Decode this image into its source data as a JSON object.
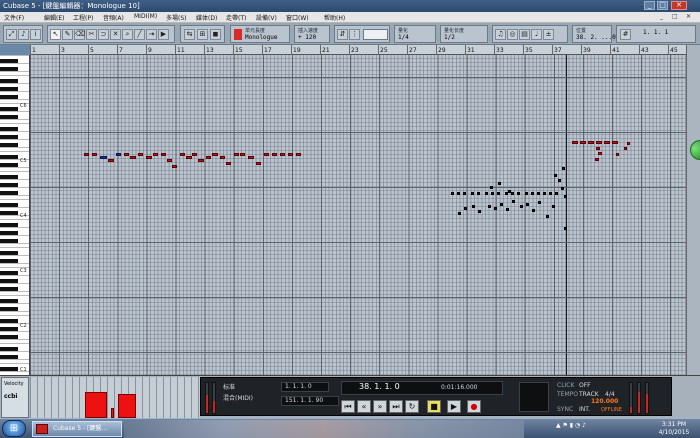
{
  "window": {
    "title": "Cubase 5 - [鍵盤編輯器：Monologue 10]",
    "buttons": [
      "_",
      "□",
      "✕"
    ]
  },
  "menubar": {
    "items": [
      "文件(F)",
      "編輯(E)",
      "工程(P)",
      "音頻(A)",
      "MIDI(M)",
      "多場(S)",
      "媒体(D)",
      "走帶(T)",
      "設備(V)",
      "窗口(W)",
      "帮助(H)"
    ],
    "system_buttons": [
      "_",
      "□",
      "✕"
    ]
  },
  "toolbar": {
    "insert_label": "单元長度",
    "insert_value": "Monologue",
    "quant_label": "插入速度",
    "quant_value": "+ 120",
    "snap_label": "量化",
    "snap_value": "1/4",
    "length_label": "量化长度",
    "length_value": "1/2",
    "pos_label": "位置",
    "pos_value": "38. 2. ...0",
    "end_value": "1. 1. 1",
    "tools": [
      "select",
      "pencil",
      "eraser",
      "scissors",
      "glue",
      "mute",
      "zoom",
      "line",
      "trim",
      "play"
    ]
  },
  "ruler": {
    "marks": [
      "1",
      "3",
      "5",
      "7",
      "9",
      "11",
      "13",
      "15",
      "17",
      "19",
      "21",
      "23",
      "25",
      "27",
      "29",
      "31",
      "33",
      "35",
      "37",
      "39",
      "41",
      "43",
      "45"
    ]
  },
  "keyboard": {
    "labels": [
      "C6",
      "C5",
      "C4",
      "C3",
      "C2",
      "C1"
    ]
  },
  "controller": {
    "label": "Velocity",
    "value": "ccbi"
  },
  "transport": {
    "mode1": "标准",
    "mode2": "混合(MIDI)",
    "left_locator": "1. 1. 1. 0",
    "right_locator": "151. 1. 1. 90",
    "primary_time": "38. 1. 1. 0",
    "secondary_time": "0:01:16.000",
    "click_label": "CLICK",
    "click_state": "OFF",
    "tempo_label": "TEMPO",
    "tempo_track": "TRACK",
    "tempo_value": "120.000",
    "signature": "4/4",
    "sync_label": "SYNC",
    "sync_state": "INT.",
    "offline": "OFFLINE",
    "buttons": [
      "|<",
      "<<",
      ">>",
      ">|",
      "loop",
      "stop",
      "play",
      "rec"
    ]
  },
  "taskbar": {
    "app_label": "Cubase 5 - [鍵盤…",
    "time": "3:31 PM",
    "date": "4/10/2015"
  },
  "colors": {
    "note": "#b3161b",
    "note_selected": "#1d2f9e",
    "grid_bg": "#bcc5cf",
    "velocity": "#ee1111",
    "transport_bg": "#1f2327",
    "tempo_value_color": "#ff7a1a"
  },
  "icons": {
    "start": "windows-orb-icon",
    "app": "cubase-icon",
    "scroll_thumb": "green-orb-icon"
  }
}
